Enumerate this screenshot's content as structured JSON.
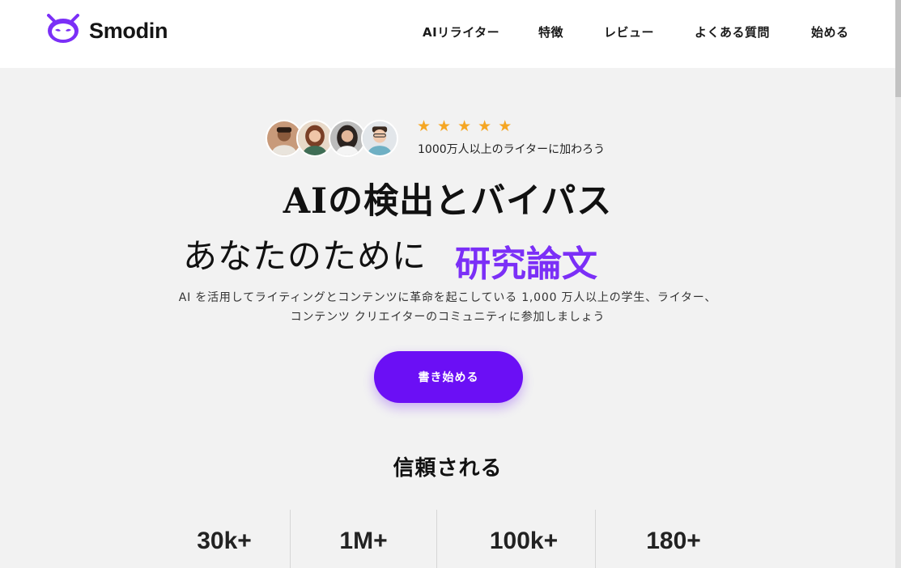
{
  "brand": {
    "name": "Smodin",
    "color": "#7b2ff7",
    "logo_icon": "robot-head-icon"
  },
  "nav": {
    "items": [
      {
        "label": "AIリライター"
      },
      {
        "label": "特徴"
      },
      {
        "label": "レビュー"
      },
      {
        "label": "よくある質問"
      },
      {
        "label": "始める"
      }
    ]
  },
  "hero": {
    "rating_stars": 5,
    "star_color": "#f5a623",
    "join_text": "1000万人以上のライターに加わろう",
    "title_line1": "AIの検出とバイパス",
    "title_line2": "あなたのために",
    "title_accent": "研究論文",
    "accent_color": "#7b2ff7",
    "subtitle": "AI を活用してライティングとコンテンツに革命を起こしている 1,000 万人以上の学生、ライター、コンテンツ クリエイターのコミュニティに参加しましょう",
    "cta_label": "書き始める",
    "cta_color": "#6b0ff5"
  },
  "trust": {
    "heading": "信頼される",
    "stats": [
      {
        "value": "30k+"
      },
      {
        "value": "1M+"
      },
      {
        "value": "100k+"
      },
      {
        "value": "180+"
      }
    ]
  }
}
